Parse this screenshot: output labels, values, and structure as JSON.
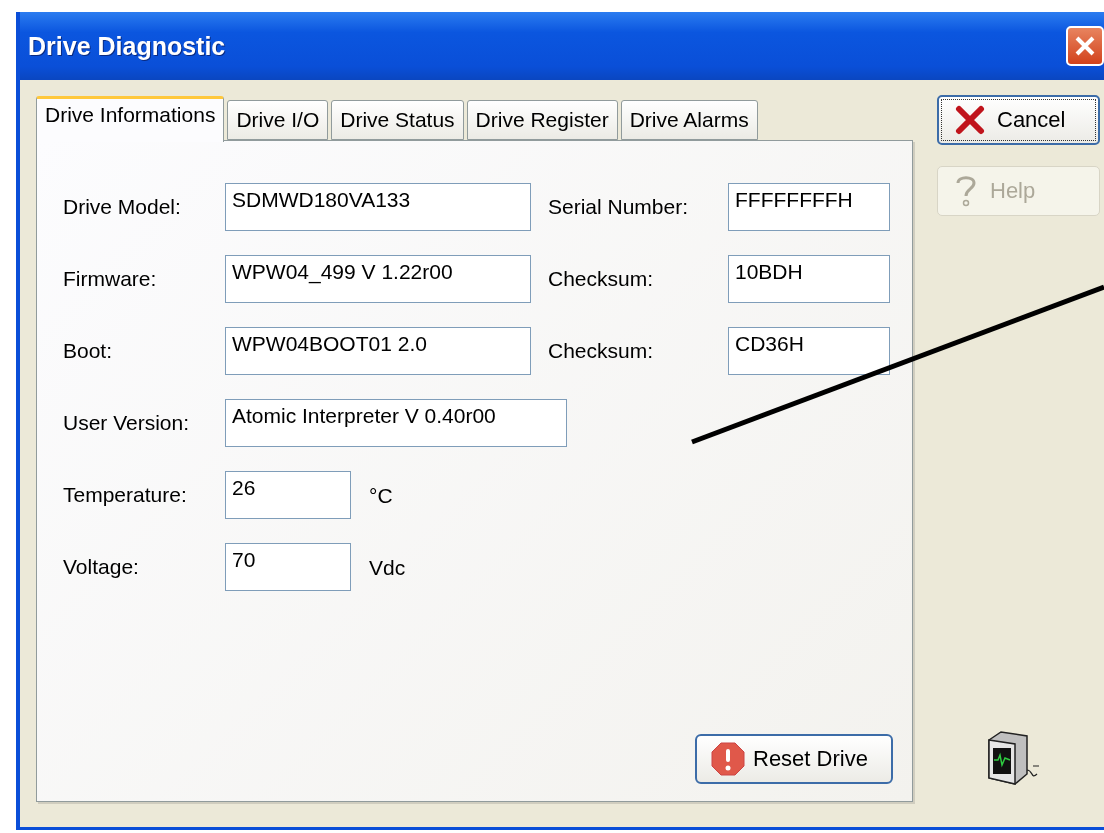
{
  "window": {
    "title": "Drive Diagnostic"
  },
  "tabs": [
    {
      "label": "Drive Informations",
      "selected": true
    },
    {
      "label": "Drive I/O",
      "selected": false
    },
    {
      "label": "Drive Status",
      "selected": false
    },
    {
      "label": "Drive Register",
      "selected": false
    },
    {
      "label": "Drive Alarms",
      "selected": false
    }
  ],
  "rows": [
    {
      "fields": [
        {
          "label": "Drive Model:",
          "value": "SDMWD180VA133"
        },
        {
          "label": "Serial Number:",
          "value": "FFFFFFFFH"
        }
      ]
    },
    {
      "fields": [
        {
          "label": "Firmware:",
          "value": "WPW04_499 V 1.22r00"
        },
        {
          "label": "Checksum:",
          "value": "10BDH"
        }
      ]
    },
    {
      "fields": [
        {
          "label": "Boot:",
          "value": "WPW04BOOT01 2.0"
        },
        {
          "label": "Checksum:",
          "value": "CD36H"
        }
      ]
    },
    {
      "fields": [
        {
          "label": "User Version:",
          "value": "Atomic Interpreter V 0.40r00"
        }
      ]
    },
    {
      "fields": [
        {
          "label": "Temperature:",
          "value": "26",
          "unit": "°C"
        }
      ]
    },
    {
      "fields": [
        {
          "label": "Voltage:",
          "value": "70",
          "unit": "Vdc"
        }
      ]
    }
  ],
  "reset_button": {
    "label": "Reset Drive"
  },
  "side_buttons": [
    {
      "kind": "cancel",
      "label": "Cancel",
      "disabled": false
    },
    {
      "kind": "help",
      "label": "Help",
      "disabled": true
    }
  ]
}
